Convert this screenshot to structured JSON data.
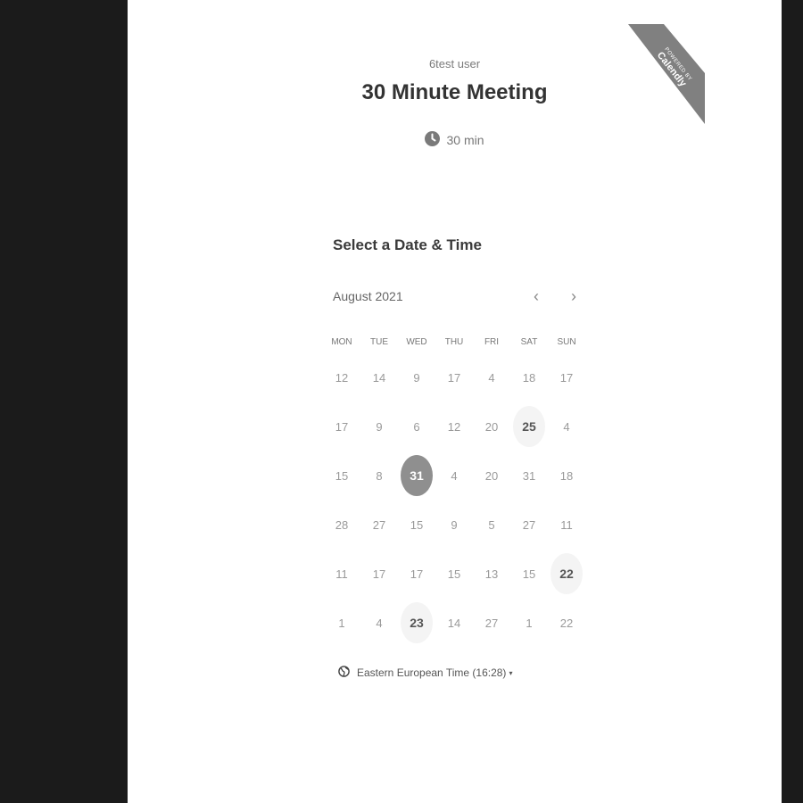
{
  "event": {
    "owner": "6test user",
    "title": "30 Minute Meeting",
    "duration": "30 min"
  },
  "ribbon": {
    "small": "POWERED BY",
    "big": "Calendly",
    "color": "#808080"
  },
  "calendar": {
    "section_title": "Select a Date & Time",
    "month_label": "August 2021",
    "prev_label": "‹",
    "next_label": "›",
    "weekdays": [
      "MON",
      "TUE",
      "WED",
      "THU",
      "FRI",
      "SAT",
      "SUN"
    ],
    "weeks": [
      [
        "12",
        "14",
        "9",
        "17",
        "4",
        "18",
        "17"
      ],
      [
        "17",
        "9",
        "6",
        "12",
        "20",
        "25",
        "4"
      ],
      [
        "15",
        "8",
        "31",
        "4",
        "20",
        "31",
        "18"
      ],
      [
        "28",
        "27",
        "15",
        "9",
        "5",
        "27",
        "11"
      ],
      [
        "11",
        "17",
        "17",
        "15",
        "13",
        "15",
        "22"
      ],
      [
        "1",
        "4",
        "23",
        "14",
        "27",
        "1",
        "22"
      ]
    ],
    "available": [
      [
        1,
        5
      ],
      [
        2,
        2
      ],
      [
        4,
        6
      ],
      [
        5,
        2
      ]
    ],
    "selected": [
      2,
      2
    ]
  },
  "timezone": {
    "label": "Eastern European Time (16:28)",
    "caret": "▾"
  },
  "colors": {
    "selected": "#8f8f8f",
    "available_bg": "#f4f4f4",
    "page_bg": "#1b1b1b"
  }
}
